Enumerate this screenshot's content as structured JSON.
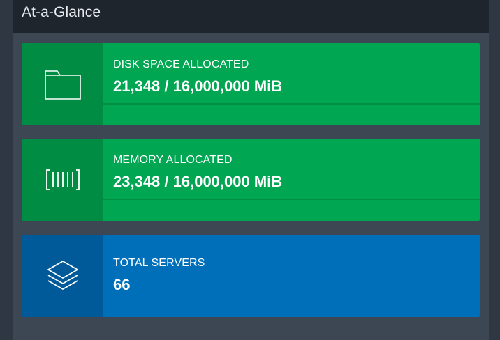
{
  "panel": {
    "title": "At-a-Glance"
  },
  "cards": [
    {
      "label": "DISK SPACE ALLOCATED",
      "value": "21,348 / 16,000,000 MiB",
      "icon": "folder-icon",
      "color": "#00a651",
      "progress_percent": 0.13
    },
    {
      "label": "MEMORY ALLOCATED",
      "value": "23,348 / 16,000,000 MiB",
      "icon": "memory-icon",
      "color": "#00a651",
      "progress_percent": 0.15
    },
    {
      "label": "TOTAL SERVERS",
      "value": "66",
      "icon": "layers-icon",
      "color": "#006fba"
    }
  ]
}
